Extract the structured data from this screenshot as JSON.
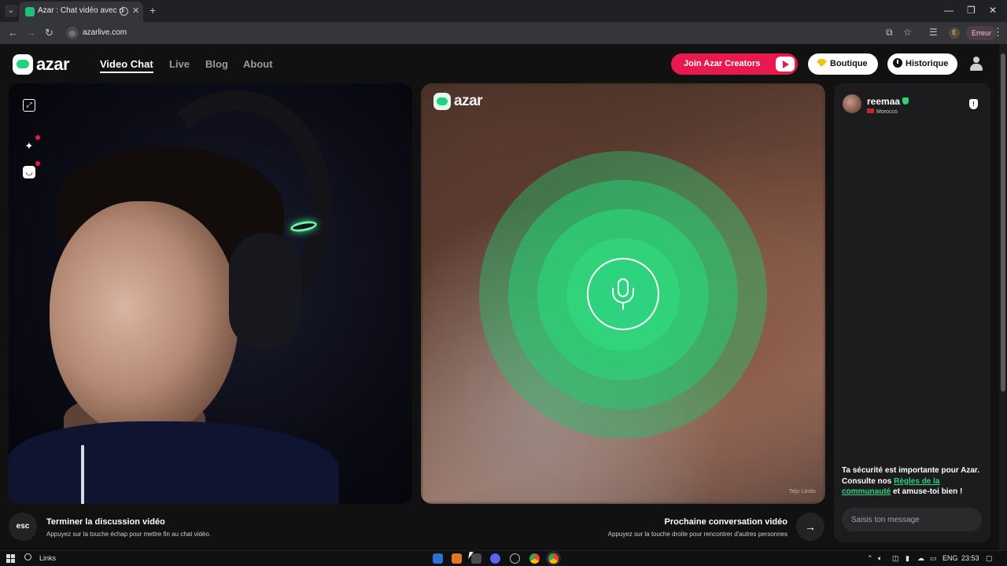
{
  "browser": {
    "tab_title": "Azar : Chat vidéo avec de n",
    "url": "azarlive.com",
    "error_label": "Erreur",
    "profile_initial": "E"
  },
  "header": {
    "logo_text": "azar",
    "nav": [
      "Video Chat",
      "Live",
      "Blog",
      "About"
    ],
    "active_nav": "Video Chat",
    "creators_label": "Join Azar Creators",
    "boutique_label": "Boutique",
    "historique_label": "Historique"
  },
  "peer_video": {
    "logo_text": "azar",
    "watermark": "Tejiz Limits"
  },
  "chat": {
    "peer_name": "reemaa",
    "peer_country": "Morocco",
    "safety_text_before": "Ta sécurité est importante pour Azar. Consulte nos ",
    "safety_link": "Règles de la communauté",
    "safety_text_after": " et amuse-toi bien !",
    "input_placeholder": "Saisis ton message"
  },
  "controls": {
    "esc_key": "esc",
    "end_title": "Terminer la discussion vidéo",
    "end_subtitle": "Appuyez sur la touche échap pour mettre fin au chat vidéo.",
    "next_title": "Prochaine conversation vidéo",
    "next_subtitle": "Appuyez sur la touche droite pour rencontrer d'autres personnes"
  },
  "taskbar": {
    "search_label": "Links",
    "language": "ENG",
    "time": "23:53"
  },
  "colors": {
    "brand_green": "#2ed37f",
    "creators_red": "#e8194f",
    "background": "#111112"
  }
}
